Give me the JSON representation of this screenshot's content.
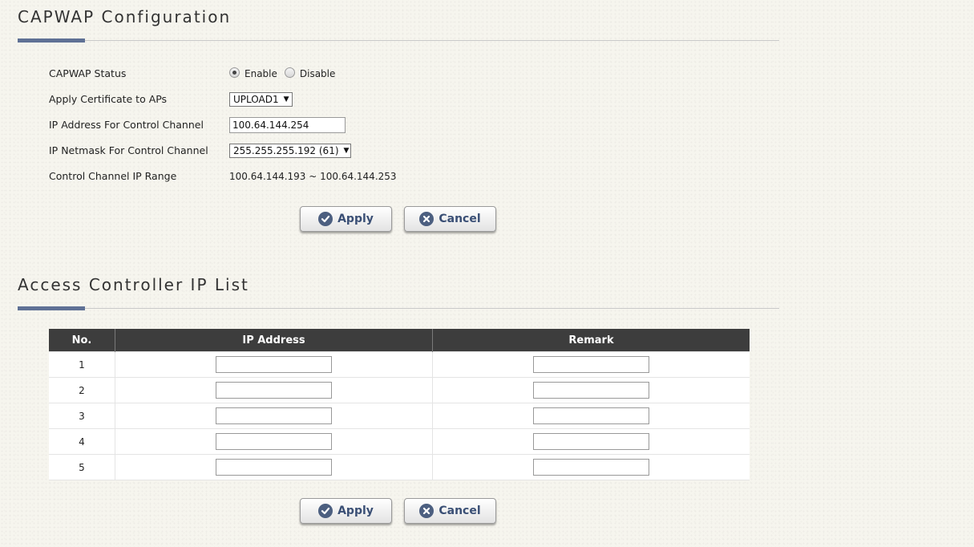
{
  "capwap": {
    "title": "CAPWAP Configuration",
    "status": {
      "label": "CAPWAP Status",
      "enable_label": "Enable",
      "disable_label": "Disable",
      "selected": "Enable"
    },
    "certificate": {
      "label": "Apply Certificate to APs",
      "value": "UPLOAD1"
    },
    "ip_address": {
      "label": "IP Address For Control Channel",
      "value": "100.64.144.254"
    },
    "netmask": {
      "label": "IP Netmask For Control Channel",
      "value": "255.255.255.192 (61)"
    },
    "ip_range": {
      "label": "Control Channel IP Range",
      "value": "100.64.144.193 ~ 100.64.144.253"
    },
    "apply_label": "Apply",
    "cancel_label": "Cancel"
  },
  "ac_list": {
    "title": "Access Controller IP List",
    "columns": [
      "No.",
      "IP Address",
      "Remark"
    ],
    "rows": [
      {
        "no": "1",
        "ip": "",
        "remark": ""
      },
      {
        "no": "2",
        "ip": "",
        "remark": ""
      },
      {
        "no": "3",
        "ip": "",
        "remark": ""
      },
      {
        "no": "4",
        "ip": "",
        "remark": ""
      },
      {
        "no": "5",
        "ip": "",
        "remark": ""
      }
    ],
    "apply_label": "Apply",
    "cancel_label": "Cancel"
  },
  "colors": {
    "accent": "#5f7195",
    "button_text": "#3a4f75",
    "table_header": "#3d3d3d"
  },
  "icons": {
    "apply": "check-circle-icon",
    "cancel": "x-circle-icon"
  }
}
